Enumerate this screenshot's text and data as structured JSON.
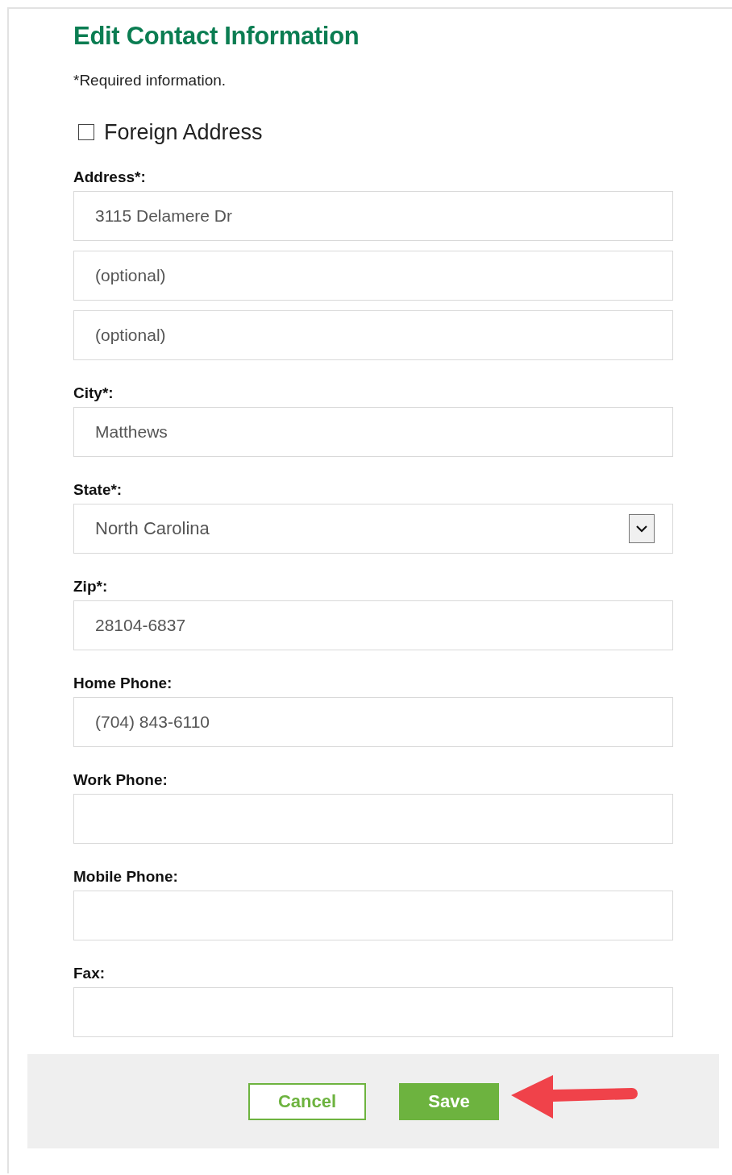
{
  "title": "Edit Contact Information",
  "note": "*Required information.",
  "foreign_address": {
    "label": "Foreign Address",
    "checked": false
  },
  "groups": [
    {
      "label": "Address*:",
      "fields": [
        {
          "kind": "text",
          "value": "3115 Delamere Dr"
        },
        {
          "kind": "text",
          "placeholder": "(optional)"
        },
        {
          "kind": "text",
          "placeholder": "(optional)"
        }
      ]
    },
    {
      "label": "City*:",
      "fields": [
        {
          "kind": "text",
          "value": "Matthews"
        }
      ]
    },
    {
      "label": "State*:",
      "fields": [
        {
          "kind": "select",
          "value": "North Carolina"
        }
      ]
    },
    {
      "label": "Zip*:",
      "fields": [
        {
          "kind": "text",
          "value": "28104-6837"
        }
      ]
    },
    {
      "label": "Home Phone:",
      "fields": [
        {
          "kind": "text",
          "value": "(704) 843-6110"
        }
      ]
    },
    {
      "label": "Work Phone:",
      "fields": [
        {
          "kind": "text"
        }
      ]
    },
    {
      "label": "Mobile Phone:",
      "fields": [
        {
          "kind": "text"
        }
      ]
    },
    {
      "label": "Fax:",
      "fields": [
        {
          "kind": "text"
        }
      ]
    }
  ],
  "buttons": [
    {
      "label": "Cancel",
      "kind": "secondary"
    },
    {
      "label": "Save",
      "kind": "primary"
    }
  ]
}
